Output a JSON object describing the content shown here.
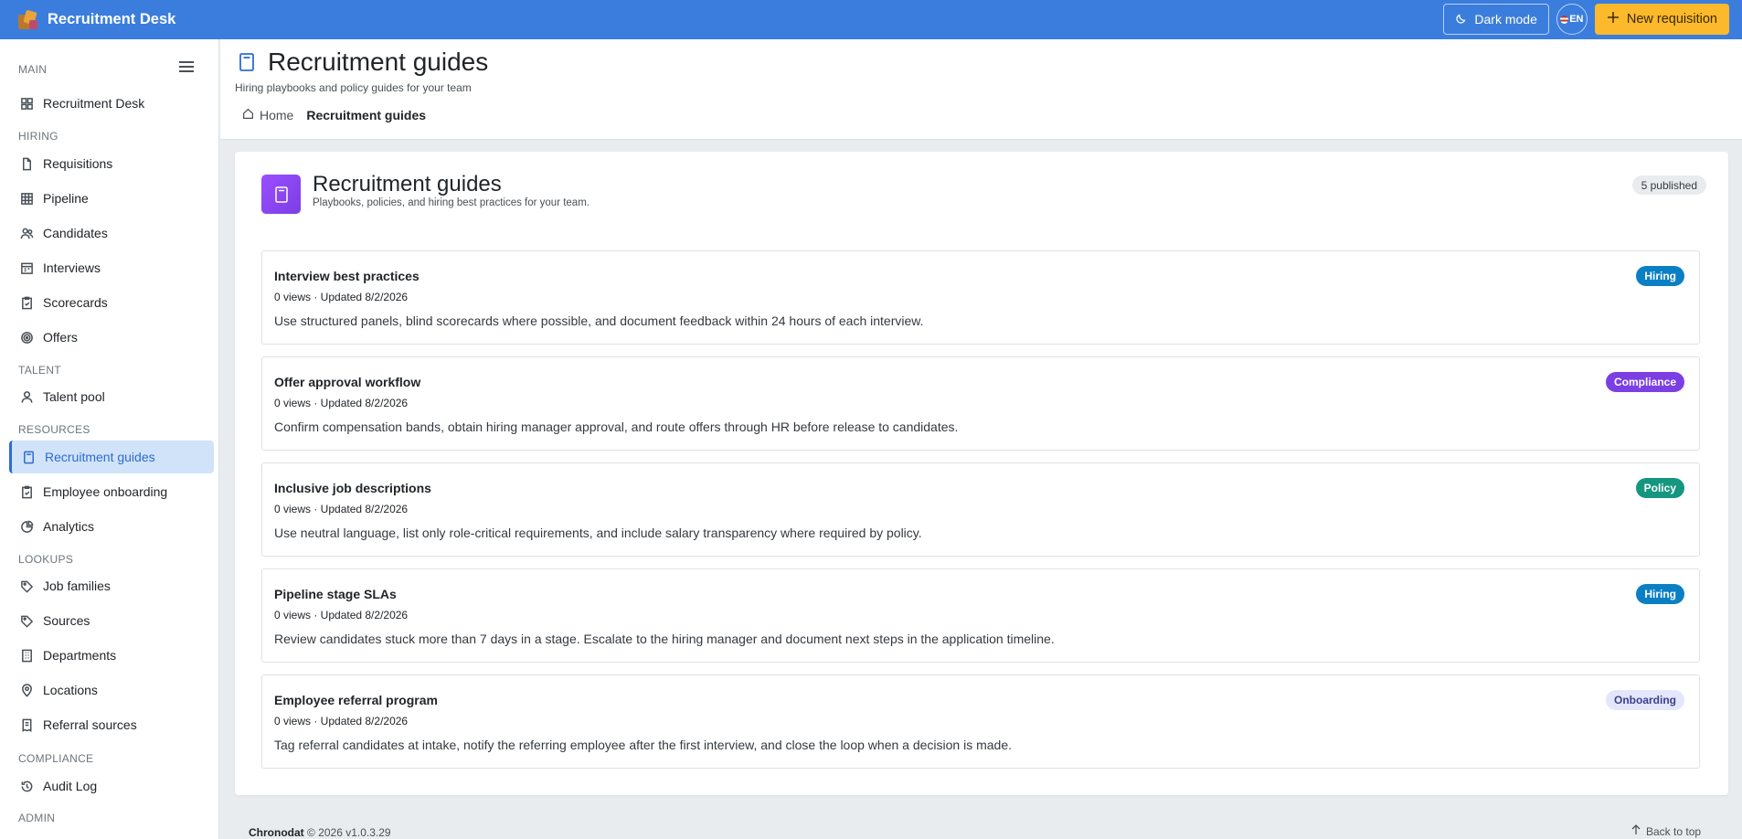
{
  "app": {
    "title": "Recruitment Desk"
  },
  "topbar": {
    "dark_mode_label": "Dark mode",
    "lang_label": "EN",
    "new_button_label": "New requisition"
  },
  "sidebar": {
    "sections": {
      "main": "MAIN",
      "hiring": "HIRING",
      "talent": "TALENT",
      "resources": "RESOURCES",
      "lookups": "LOOKUPS",
      "compliance": "COMPLIANCE",
      "admin": "ADMIN"
    },
    "items": [
      {
        "label": "Recruitment Desk",
        "icon": "dashboard-icon"
      },
      {
        "label": "Requisitions",
        "icon": "document-icon"
      },
      {
        "label": "Pipeline",
        "icon": "grid-icon"
      },
      {
        "label": "Candidates",
        "icon": "people-icon"
      },
      {
        "label": "Interviews",
        "icon": "calendar-icon"
      },
      {
        "label": "Scorecards",
        "icon": "clipboard-icon"
      },
      {
        "label": "Offers",
        "icon": "target-icon"
      },
      {
        "label": "Talent pool",
        "icon": "person-icon"
      },
      {
        "label": "Recruitment guides",
        "icon": "book-icon",
        "active": true
      },
      {
        "label": "Employee onboarding",
        "icon": "clipboard-check-icon"
      },
      {
        "label": "Analytics",
        "icon": "chart-icon"
      },
      {
        "label": "Job families",
        "icon": "tag-icon"
      },
      {
        "label": "Sources",
        "icon": "tag-icon"
      },
      {
        "label": "Departments",
        "icon": "building-icon"
      },
      {
        "label": "Locations",
        "icon": "location-icon"
      },
      {
        "label": "Referral sources",
        "icon": "receipt-icon"
      },
      {
        "label": "Audit Log",
        "icon": "history-icon"
      }
    ]
  },
  "header": {
    "title": "Recruitment guides",
    "subtitle": "Hiring playbooks and policy guides for your team",
    "breadcrumb": {
      "home": "Home",
      "current": "Recruitment guides"
    }
  },
  "main": {
    "title": "Recruitment guides",
    "subtitle": "Playbooks, policies, and hiring best practices for your team.",
    "count_label": "5 published",
    "guides": [
      {
        "title": "Interview best practices",
        "meta": "0 views · Updated 8/2/2026",
        "description": "Use structured panels, blind scorecards where possible, and document feedback within 24 hours of each interview.",
        "tag": "Hiring",
        "tag_color": "#0b7fc4"
      },
      {
        "title": "Offer approval workflow",
        "meta": "0 views · Updated 8/2/2026",
        "description": "Confirm compensation bands, obtain hiring manager approval, and route offers through HR before release to candidates.",
        "tag": "Compliance",
        "tag_color": "#7b3fe4"
      },
      {
        "title": "Inclusive job descriptions",
        "meta": "0 views · Updated 8/2/2026",
        "description": "Use neutral language, list only role-critical requirements, and include salary transparency where required by policy.",
        "tag": "Policy",
        "tag_color": "#14967f"
      },
      {
        "title": "Pipeline stage SLAs",
        "meta": "0 views · Updated 8/2/2026",
        "description": "Review candidates stuck more than 7 days in a stage. Escalate to the hiring manager and document next steps in the application timeline.",
        "tag": "Hiring",
        "tag_color": "#0b7fc4"
      },
      {
        "title": "Employee referral program",
        "meta": "0 views · Updated 8/2/2026",
        "description": "Tag referral candidates at intake, notify the referring employee after the first interview, and close the loop when a decision is made.",
        "tag": "Onboarding",
        "tag_color": "#e4e6fb"
      }
    ]
  },
  "footer": {
    "brand": "Chronodat",
    "copyright": "© 2026",
    "version": "v1.0.3.29",
    "back_to_top": "Back to top"
  }
}
